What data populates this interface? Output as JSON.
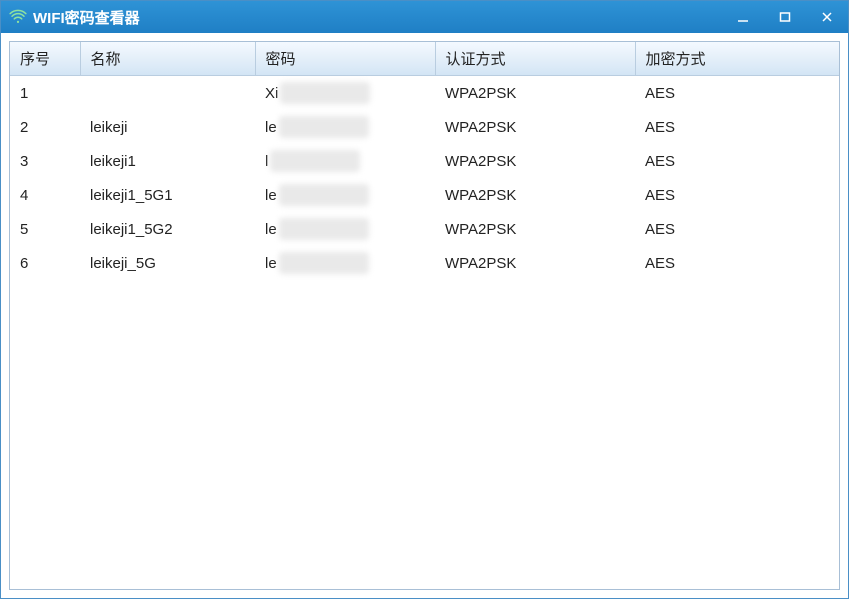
{
  "window": {
    "title": "WIFI密码查看器"
  },
  "table": {
    "headers": {
      "index": "序号",
      "name": "名称",
      "password": "密码",
      "auth": "认证方式",
      "encryption": "加密方式"
    },
    "rows": [
      {
        "index": "1",
        "name": "",
        "pw_prefix": "Xi",
        "auth": "WPA2PSK",
        "enc": "AES"
      },
      {
        "index": "2",
        "name": "leikeji",
        "pw_prefix": "le",
        "auth": "WPA2PSK",
        "enc": "AES"
      },
      {
        "index": "3",
        "name": "leikeji1",
        "pw_prefix": "l",
        "auth": "WPA2PSK",
        "enc": "AES"
      },
      {
        "index": "4",
        "name": "leikeji1_5G1",
        "pw_prefix": "le",
        "auth": "WPA2PSK",
        "enc": "AES"
      },
      {
        "index": "5",
        "name": "leikeji1_5G2",
        "pw_prefix": "le",
        "auth": "WPA2PSK",
        "enc": "AES"
      },
      {
        "index": "6",
        "name": "leikeji_5G",
        "pw_prefix": "le",
        "auth": "WPA2PSK",
        "enc": "AES"
      }
    ]
  }
}
